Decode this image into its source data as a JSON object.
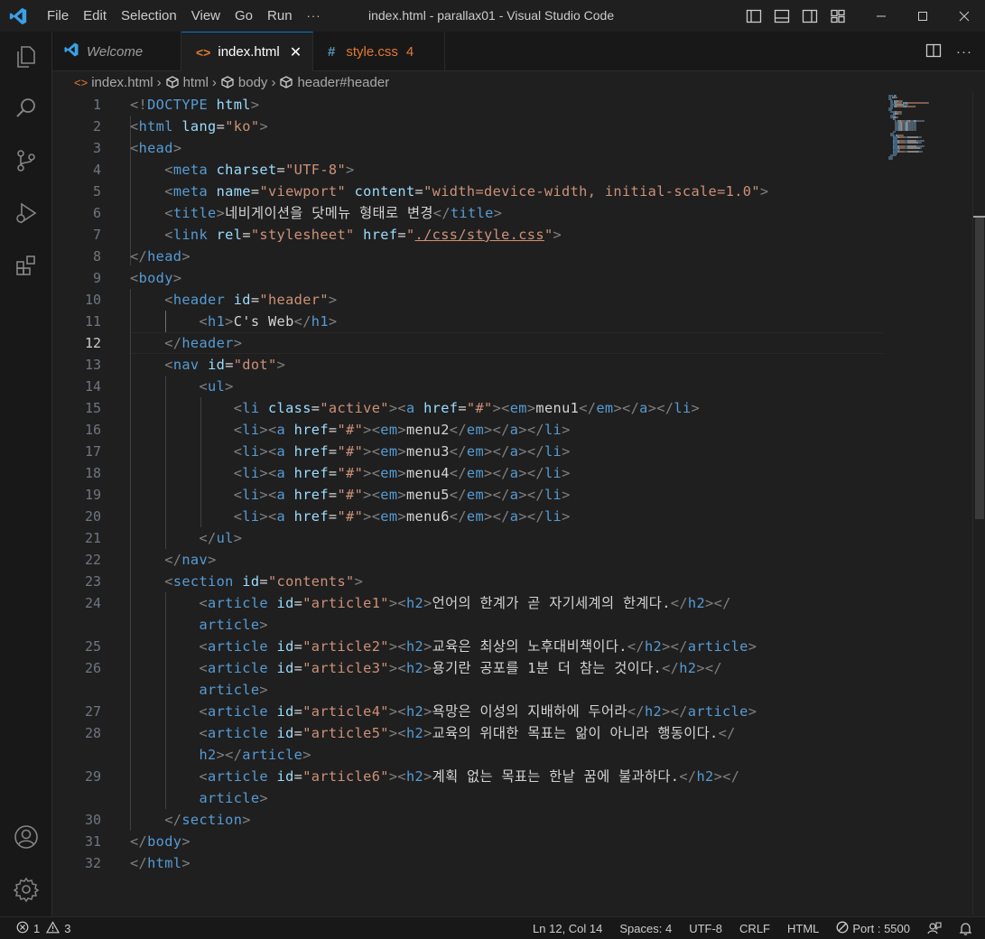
{
  "titlebar": {
    "menus": [
      "File",
      "Edit",
      "Selection",
      "View",
      "Go",
      "Run",
      "···"
    ],
    "title": "index.html - parallax01 - Visual Studio Code"
  },
  "tabs": [
    {
      "label": "Welcome",
      "icon": "vscode-logo-icon"
    },
    {
      "label": "index.html",
      "icon": "html-file-icon",
      "close": "✕"
    },
    {
      "label": "style.css",
      "icon": "css-file-icon",
      "badge": "4",
      "prefix": "#"
    }
  ],
  "breadcrumb": {
    "file": "index.html",
    "items": [
      "html",
      "body",
      "header#header"
    ]
  },
  "editor": {
    "current_line": 12,
    "line_numbers": [
      "1",
      "2",
      "3",
      "4",
      "5",
      "6",
      "7",
      "8",
      "9",
      "10",
      "11",
      "12",
      "13",
      "14",
      "15",
      "16",
      "17",
      "18",
      "19",
      "20",
      "21",
      "22",
      "23",
      "24",
      "",
      "25",
      "26",
      "",
      "27",
      "28",
      "",
      "29",
      "",
      "30",
      "31",
      "32"
    ]
  },
  "code_lines": [
    [
      [
        "punct",
        "<!"
      ],
      [
        "tag",
        "DOCTYPE"
      ],
      [
        "text",
        " "
      ],
      [
        "attr",
        "html"
      ],
      [
        "punct",
        ">"
      ]
    ],
    [
      [
        "punct",
        "<"
      ],
      [
        "tag",
        "html"
      ],
      [
        "text",
        " "
      ],
      [
        "attr",
        "lang"
      ],
      [
        "text",
        "="
      ],
      [
        "str",
        "\"ko\""
      ],
      [
        "punct",
        ">"
      ]
    ],
    [
      [
        "punct",
        "<"
      ],
      [
        "tag",
        "head"
      ],
      [
        "punct",
        ">"
      ]
    ],
    [
      [
        "text",
        "    "
      ],
      [
        "punct",
        "<"
      ],
      [
        "tag",
        "meta"
      ],
      [
        "text",
        " "
      ],
      [
        "attr",
        "charset"
      ],
      [
        "text",
        "="
      ],
      [
        "str",
        "\"UTF-8\""
      ],
      [
        "punct",
        ">"
      ]
    ],
    [
      [
        "text",
        "    "
      ],
      [
        "punct",
        "<"
      ],
      [
        "tag",
        "meta"
      ],
      [
        "text",
        " "
      ],
      [
        "attr",
        "name"
      ],
      [
        "text",
        "="
      ],
      [
        "str",
        "\"viewport\""
      ],
      [
        "text",
        " "
      ],
      [
        "attr",
        "content"
      ],
      [
        "text",
        "="
      ],
      [
        "str",
        "\"width=device-width, initial-scale=1.0\""
      ],
      [
        "punct",
        ">"
      ]
    ],
    [
      [
        "text",
        "    "
      ],
      [
        "punct",
        "<"
      ],
      [
        "tag",
        "title"
      ],
      [
        "punct",
        ">"
      ],
      [
        "text",
        "네비게이션을 닷메뉴 형태로 변경"
      ],
      [
        "punct",
        "</"
      ],
      [
        "tag",
        "title"
      ],
      [
        "punct",
        ">"
      ]
    ],
    [
      [
        "text",
        "    "
      ],
      [
        "punct",
        "<"
      ],
      [
        "tag",
        "link"
      ],
      [
        "text",
        " "
      ],
      [
        "attr",
        "rel"
      ],
      [
        "text",
        "="
      ],
      [
        "str",
        "\"stylesheet\""
      ],
      [
        "text",
        " "
      ],
      [
        "attr",
        "href"
      ],
      [
        "text",
        "="
      ],
      [
        "str",
        "\""
      ],
      [
        "link",
        "./css/style.css"
      ],
      [
        "str",
        "\""
      ],
      [
        "punct",
        ">"
      ]
    ],
    [
      [
        "punct",
        "</"
      ],
      [
        "tag",
        "head"
      ],
      [
        "punct",
        ">"
      ]
    ],
    [
      [
        "punct",
        "<"
      ],
      [
        "tag",
        "body"
      ],
      [
        "punct",
        ">"
      ]
    ],
    [
      [
        "text",
        "    "
      ],
      [
        "punct",
        "<"
      ],
      [
        "tag",
        "header"
      ],
      [
        "text",
        " "
      ],
      [
        "attr",
        "id"
      ],
      [
        "text",
        "="
      ],
      [
        "str",
        "\"header\""
      ],
      [
        "punct",
        ">"
      ]
    ],
    [
      [
        "text",
        "        "
      ],
      [
        "punct",
        "<"
      ],
      [
        "tag",
        "h1"
      ],
      [
        "punct",
        ">"
      ],
      [
        "text",
        "C's Web"
      ],
      [
        "punct",
        "</"
      ],
      [
        "tag",
        "h1"
      ],
      [
        "punct",
        ">"
      ]
    ],
    [
      [
        "text",
        "    "
      ],
      [
        "punct",
        "</"
      ],
      [
        "tag",
        "header"
      ],
      [
        "punct",
        ">"
      ]
    ],
    [
      [
        "text",
        "    "
      ],
      [
        "punct",
        "<"
      ],
      [
        "tag",
        "nav"
      ],
      [
        "text",
        " "
      ],
      [
        "attr",
        "id"
      ],
      [
        "text",
        "="
      ],
      [
        "str",
        "\"dot\""
      ],
      [
        "punct",
        ">"
      ]
    ],
    [
      [
        "text",
        "        "
      ],
      [
        "punct",
        "<"
      ],
      [
        "tag",
        "ul"
      ],
      [
        "punct",
        ">"
      ]
    ],
    [
      [
        "text",
        "            "
      ],
      [
        "punct",
        "<"
      ],
      [
        "tag",
        "li"
      ],
      [
        "text",
        " "
      ],
      [
        "attr",
        "class"
      ],
      [
        "text",
        "="
      ],
      [
        "str",
        "\"active\""
      ],
      [
        "punct",
        "><"
      ],
      [
        "tag",
        "a"
      ],
      [
        "text",
        " "
      ],
      [
        "attr",
        "href"
      ],
      [
        "text",
        "="
      ],
      [
        "str",
        "\"#\""
      ],
      [
        "punct",
        "><"
      ],
      [
        "tag",
        "em"
      ],
      [
        "punct",
        ">"
      ],
      [
        "text",
        "menu1"
      ],
      [
        "punct",
        "</"
      ],
      [
        "tag",
        "em"
      ],
      [
        "punct",
        "></"
      ],
      [
        "tag",
        "a"
      ],
      [
        "punct",
        "></"
      ],
      [
        "tag",
        "li"
      ],
      [
        "punct",
        ">"
      ]
    ],
    [
      [
        "text",
        "            "
      ],
      [
        "punct",
        "<"
      ],
      [
        "tag",
        "li"
      ],
      [
        "punct",
        "><"
      ],
      [
        "tag",
        "a"
      ],
      [
        "text",
        " "
      ],
      [
        "attr",
        "href"
      ],
      [
        "text",
        "="
      ],
      [
        "str",
        "\"#\""
      ],
      [
        "punct",
        "><"
      ],
      [
        "tag",
        "em"
      ],
      [
        "punct",
        ">"
      ],
      [
        "text",
        "menu2"
      ],
      [
        "punct",
        "</"
      ],
      [
        "tag",
        "em"
      ],
      [
        "punct",
        "></"
      ],
      [
        "tag",
        "a"
      ],
      [
        "punct",
        "></"
      ],
      [
        "tag",
        "li"
      ],
      [
        "punct",
        ">"
      ]
    ],
    [
      [
        "text",
        "            "
      ],
      [
        "punct",
        "<"
      ],
      [
        "tag",
        "li"
      ],
      [
        "punct",
        "><"
      ],
      [
        "tag",
        "a"
      ],
      [
        "text",
        " "
      ],
      [
        "attr",
        "href"
      ],
      [
        "text",
        "="
      ],
      [
        "str",
        "\"#\""
      ],
      [
        "punct",
        "><"
      ],
      [
        "tag",
        "em"
      ],
      [
        "punct",
        ">"
      ],
      [
        "text",
        "menu3"
      ],
      [
        "punct",
        "</"
      ],
      [
        "tag",
        "em"
      ],
      [
        "punct",
        "></"
      ],
      [
        "tag",
        "a"
      ],
      [
        "punct",
        "></"
      ],
      [
        "tag",
        "li"
      ],
      [
        "punct",
        ">"
      ]
    ],
    [
      [
        "text",
        "            "
      ],
      [
        "punct",
        "<"
      ],
      [
        "tag",
        "li"
      ],
      [
        "punct",
        "><"
      ],
      [
        "tag",
        "a"
      ],
      [
        "text",
        " "
      ],
      [
        "attr",
        "href"
      ],
      [
        "text",
        "="
      ],
      [
        "str",
        "\"#\""
      ],
      [
        "punct",
        "><"
      ],
      [
        "tag",
        "em"
      ],
      [
        "punct",
        ">"
      ],
      [
        "text",
        "menu4"
      ],
      [
        "punct",
        "</"
      ],
      [
        "tag",
        "em"
      ],
      [
        "punct",
        "></"
      ],
      [
        "tag",
        "a"
      ],
      [
        "punct",
        "></"
      ],
      [
        "tag",
        "li"
      ],
      [
        "punct",
        ">"
      ]
    ],
    [
      [
        "text",
        "            "
      ],
      [
        "punct",
        "<"
      ],
      [
        "tag",
        "li"
      ],
      [
        "punct",
        "><"
      ],
      [
        "tag",
        "a"
      ],
      [
        "text",
        " "
      ],
      [
        "attr",
        "href"
      ],
      [
        "text",
        "="
      ],
      [
        "str",
        "\"#\""
      ],
      [
        "punct",
        "><"
      ],
      [
        "tag",
        "em"
      ],
      [
        "punct",
        ">"
      ],
      [
        "text",
        "menu5"
      ],
      [
        "punct",
        "</"
      ],
      [
        "tag",
        "em"
      ],
      [
        "punct",
        "></"
      ],
      [
        "tag",
        "a"
      ],
      [
        "punct",
        "></"
      ],
      [
        "tag",
        "li"
      ],
      [
        "punct",
        ">"
      ]
    ],
    [
      [
        "text",
        "            "
      ],
      [
        "punct",
        "<"
      ],
      [
        "tag",
        "li"
      ],
      [
        "punct",
        "><"
      ],
      [
        "tag",
        "a"
      ],
      [
        "text",
        " "
      ],
      [
        "attr",
        "href"
      ],
      [
        "text",
        "="
      ],
      [
        "str",
        "\"#\""
      ],
      [
        "punct",
        "><"
      ],
      [
        "tag",
        "em"
      ],
      [
        "punct",
        ">"
      ],
      [
        "text",
        "menu6"
      ],
      [
        "punct",
        "</"
      ],
      [
        "tag",
        "em"
      ],
      [
        "punct",
        "></"
      ],
      [
        "tag",
        "a"
      ],
      [
        "punct",
        "></"
      ],
      [
        "tag",
        "li"
      ],
      [
        "punct",
        ">"
      ]
    ],
    [
      [
        "text",
        "        "
      ],
      [
        "punct",
        "</"
      ],
      [
        "tag",
        "ul"
      ],
      [
        "punct",
        ">"
      ]
    ],
    [
      [
        "text",
        "    "
      ],
      [
        "punct",
        "</"
      ],
      [
        "tag",
        "nav"
      ],
      [
        "punct",
        ">"
      ]
    ],
    [
      [
        "text",
        "    "
      ],
      [
        "punct",
        "<"
      ],
      [
        "tag",
        "section"
      ],
      [
        "text",
        " "
      ],
      [
        "attr",
        "id"
      ],
      [
        "text",
        "="
      ],
      [
        "str",
        "\"contents\""
      ],
      [
        "punct",
        ">"
      ]
    ],
    [
      [
        "text",
        "        "
      ],
      [
        "punct",
        "<"
      ],
      [
        "tag",
        "article"
      ],
      [
        "text",
        " "
      ],
      [
        "attr",
        "id"
      ],
      [
        "text",
        "="
      ],
      [
        "str",
        "\"article1\""
      ],
      [
        "punct",
        "><"
      ],
      [
        "tag",
        "h2"
      ],
      [
        "punct",
        ">"
      ],
      [
        "text",
        "언어의 한계가 곧 자기세계의 한계다."
      ],
      [
        "punct",
        "</"
      ],
      [
        "tag",
        "h2"
      ],
      [
        "punct",
        "></"
      ]
    ],
    [
      [
        "text",
        "        "
      ],
      [
        "tag",
        "article"
      ],
      [
        "punct",
        ">"
      ]
    ],
    [
      [
        "text",
        "        "
      ],
      [
        "punct",
        "<"
      ],
      [
        "tag",
        "article"
      ],
      [
        "text",
        " "
      ],
      [
        "attr",
        "id"
      ],
      [
        "text",
        "="
      ],
      [
        "str",
        "\"article2\""
      ],
      [
        "punct",
        "><"
      ],
      [
        "tag",
        "h2"
      ],
      [
        "punct",
        ">"
      ],
      [
        "text",
        "교육은 최상의 노후대비책이다."
      ],
      [
        "punct",
        "</"
      ],
      [
        "tag",
        "h2"
      ],
      [
        "punct",
        "></"
      ],
      [
        "tag",
        "article"
      ],
      [
        "punct",
        ">"
      ]
    ],
    [
      [
        "text",
        "        "
      ],
      [
        "punct",
        "<"
      ],
      [
        "tag",
        "article"
      ],
      [
        "text",
        " "
      ],
      [
        "attr",
        "id"
      ],
      [
        "text",
        "="
      ],
      [
        "str",
        "\"article3\""
      ],
      [
        "punct",
        "><"
      ],
      [
        "tag",
        "h2"
      ],
      [
        "punct",
        ">"
      ],
      [
        "text",
        "용기란 공포를 1분 더 참는 것이다."
      ],
      [
        "punct",
        "</"
      ],
      [
        "tag",
        "h2"
      ],
      [
        "punct",
        "></"
      ]
    ],
    [
      [
        "text",
        "        "
      ],
      [
        "tag",
        "article"
      ],
      [
        "punct",
        ">"
      ]
    ],
    [
      [
        "text",
        "        "
      ],
      [
        "punct",
        "<"
      ],
      [
        "tag",
        "article"
      ],
      [
        "text",
        " "
      ],
      [
        "attr",
        "id"
      ],
      [
        "text",
        "="
      ],
      [
        "str",
        "\"article4\""
      ],
      [
        "punct",
        "><"
      ],
      [
        "tag",
        "h2"
      ],
      [
        "punct",
        ">"
      ],
      [
        "text",
        "욕망은 이성의 지배하에 두어라"
      ],
      [
        "punct",
        "</"
      ],
      [
        "tag",
        "h2"
      ],
      [
        "punct",
        "></"
      ],
      [
        "tag",
        "article"
      ],
      [
        "punct",
        ">"
      ]
    ],
    [
      [
        "text",
        "        "
      ],
      [
        "punct",
        "<"
      ],
      [
        "tag",
        "article"
      ],
      [
        "text",
        " "
      ],
      [
        "attr",
        "id"
      ],
      [
        "text",
        "="
      ],
      [
        "str",
        "\"article5\""
      ],
      [
        "punct",
        "><"
      ],
      [
        "tag",
        "h2"
      ],
      [
        "punct",
        ">"
      ],
      [
        "text",
        "교육의 위대한 목표는 앎이 아니라 행동이다."
      ],
      [
        "punct",
        "</"
      ]
    ],
    [
      [
        "text",
        "        "
      ],
      [
        "tag",
        "h2"
      ],
      [
        "punct",
        "></"
      ],
      [
        "tag",
        "article"
      ],
      [
        "punct",
        ">"
      ]
    ],
    [
      [
        "text",
        "        "
      ],
      [
        "punct",
        "<"
      ],
      [
        "tag",
        "article"
      ],
      [
        "text",
        " "
      ],
      [
        "attr",
        "id"
      ],
      [
        "text",
        "="
      ],
      [
        "str",
        "\"article6\""
      ],
      [
        "punct",
        "><"
      ],
      [
        "tag",
        "h2"
      ],
      [
        "punct",
        ">"
      ],
      [
        "text",
        "계획 없는 목표는 한낱 꿈에 불과하다."
      ],
      [
        "punct",
        "</"
      ],
      [
        "tag",
        "h2"
      ],
      [
        "punct",
        "></"
      ]
    ],
    [
      [
        "text",
        "        "
      ],
      [
        "tag",
        "article"
      ],
      [
        "punct",
        ">"
      ]
    ],
    [
      [
        "text",
        "    "
      ],
      [
        "punct",
        "</"
      ],
      [
        "tag",
        "section"
      ],
      [
        "punct",
        ">"
      ]
    ],
    [
      [
        "punct",
        "</"
      ],
      [
        "tag",
        "body"
      ],
      [
        "punct",
        ">"
      ]
    ],
    [
      [
        "punct",
        "</"
      ],
      [
        "tag",
        "html"
      ],
      [
        "punct",
        ">"
      ]
    ]
  ],
  "statusbar": {
    "errors": "1",
    "warnings": "3",
    "position": "Ln 12, Col 14",
    "spaces": "Spaces: 4",
    "encoding": "UTF-8",
    "eol": "CRLF",
    "language": "HTML",
    "port": "Port : 5500"
  },
  "colors": {
    "accent": "#0078d4",
    "tag": "#569cd6",
    "attr": "#9cdcfe",
    "string": "#ce9178",
    "css_tab": "#e37933",
    "html_icon": "#e37933"
  }
}
